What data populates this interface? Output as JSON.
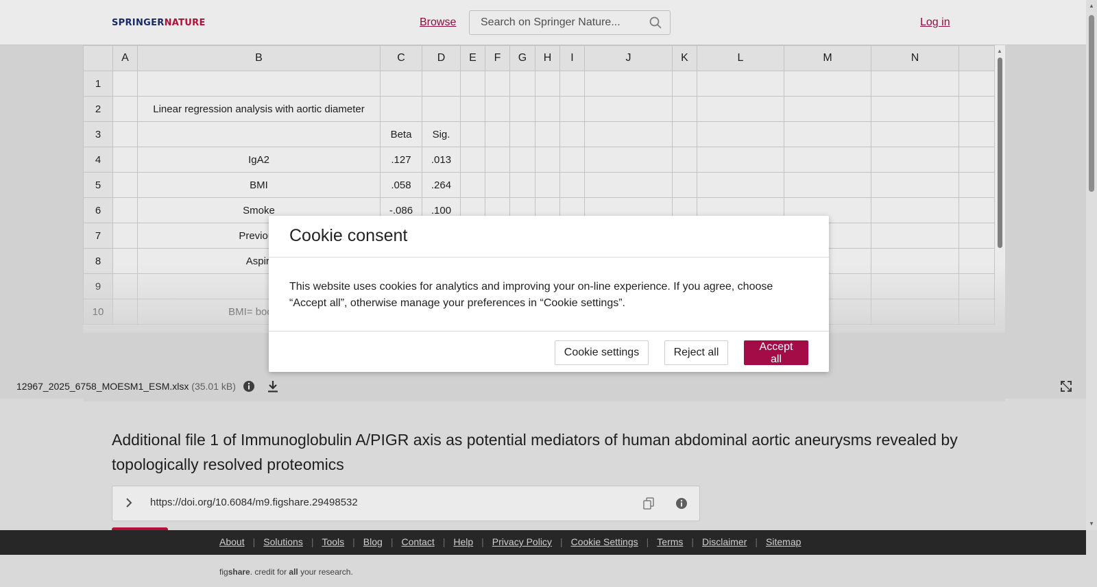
{
  "header": {
    "logo_a": "SPRINGER",
    "logo_b": "NATURE",
    "browse": "Browse",
    "search_placeholder": "Search on Springer Nature...",
    "login": "Log in"
  },
  "sheet": {
    "columns": [
      "A",
      "B",
      "C",
      "D",
      "E",
      "F",
      "G",
      "H",
      "I",
      "J",
      "K",
      "L",
      "M",
      "N"
    ],
    "rows": [
      {
        "n": "1",
        "b": "",
        "c": "",
        "d": ""
      },
      {
        "n": "2",
        "b": "Linear regression analysis with aortic diameter",
        "c": "",
        "d": ""
      },
      {
        "n": "3",
        "b": "",
        "c": "Beta",
        "d": "Sig."
      },
      {
        "n": "4",
        "b": "IgA2",
        "c": ".127",
        "d": ".013"
      },
      {
        "n": "5",
        "b": "BMI",
        "c": ".058",
        "d": ".264"
      },
      {
        "n": "6",
        "b": "Smoke",
        "c": "-.086",
        "d": ".100"
      },
      {
        "n": "7",
        "b": "Previous",
        "c": "",
        "d": ""
      },
      {
        "n": "8",
        "b": "Aspiri",
        "c": "",
        "d": ""
      },
      {
        "n": "9",
        "b": "",
        "c": "",
        "d": ""
      },
      {
        "n": "10",
        "b": "BMI= body m",
        "c": "",
        "d": ""
      }
    ]
  },
  "file": {
    "name": "12967_2025_6758_MOESM1_ESM.xlsx",
    "size": "(35.01 kB)"
  },
  "article": {
    "title": "Additional file 1 of Immunoglobulin A/PIGR axis as potential mediators of human abdominal aortic aneurysms revealed by topologically resolved proteomics",
    "doi": "https://doi.org/10.6084/m9.figshare.29498532"
  },
  "footer": {
    "links": [
      "About",
      "Solutions",
      "Tools",
      "Blog",
      "Contact",
      "Help",
      "Privacy Policy",
      "Cookie Settings",
      "Terms",
      "Disclaimer",
      "Sitemap"
    ],
    "tag_fig": "fig",
    "tag_share": "share",
    "tag_mid": ". credit for ",
    "tag_all": "all",
    "tag_end": " your research."
  },
  "cookie": {
    "title": "Cookie consent",
    "body": "This website uses cookies for analytics and improving your on-line experience. If you agree, choose “Accept all”, otherwise manage your preferences in “Cookie settings”.",
    "settings": "Cookie settings",
    "reject": "Reject all",
    "accept": "Accept all"
  },
  "colors": {
    "brand": "#9b0e44",
    "accept": "#a40c48",
    "footer_bg": "#2b2b2b"
  }
}
